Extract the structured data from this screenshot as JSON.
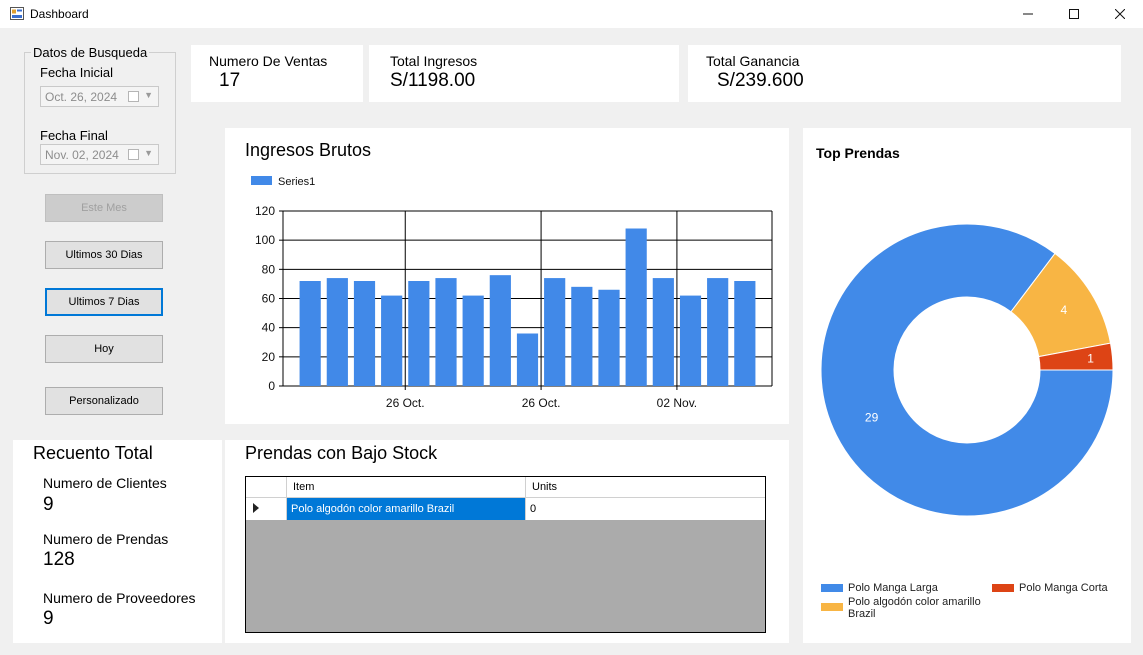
{
  "window": {
    "title": "Dashboard",
    "minimize": "—",
    "maximize": "☐",
    "close": "✕"
  },
  "search": {
    "group_title": "Datos de Busqueda",
    "start_label": "Fecha Inicial",
    "start_value": "Oct. 26, 2024",
    "end_label": "Fecha Final",
    "end_value": "Nov. 02, 2024"
  },
  "buttons": {
    "este_mes": "Este Mes",
    "ultimos_30": "Ultimos 30 Dias",
    "ultimos_7": "Ultimos 7 Dias",
    "hoy": "Hoy",
    "personalizado": "Personalizado"
  },
  "kpis": {
    "ventas": {
      "label": "Numero De Ventas",
      "value": "17"
    },
    "ingresos": {
      "label": "Total Ingresos",
      "value": "S/1198.00"
    },
    "ganancia": {
      "label": "Total Ganancia",
      "value": "S/239.600"
    }
  },
  "summary": {
    "title": "Recuento Total",
    "clientes_label": "Numero de Clientes",
    "clientes_value": "9",
    "prendas_label": "Numero de Prendas",
    "prendas_value": "128",
    "proveedores_label": "Numero de Proveedores",
    "proveedores_value": "9"
  },
  "low_stock": {
    "title": "Prendas con Bajo Stock",
    "columns": [
      "Item",
      "Units"
    ],
    "rows": [
      {
        "item": "Polo algodón color amarillo Brazil",
        "units": "0"
      }
    ]
  },
  "chart_data": [
    {
      "type": "bar",
      "title": "Ingresos Brutos",
      "series": [
        {
          "name": "Series1",
          "color": "#4189e8",
          "values": [
            72,
            74,
            72,
            62,
            72,
            74,
            62,
            76,
            36,
            74,
            68,
            66,
            108,
            74,
            62,
            74,
            72
          ]
        }
      ],
      "x_tick_labels": [
        "26 Oct.",
        "26 Oct.",
        "02 Nov."
      ],
      "ylim": [
        0,
        120
      ],
      "yticks": [
        0,
        20,
        40,
        60,
        80,
        100,
        120
      ],
      "grid": true,
      "legend": "top-left"
    },
    {
      "type": "pie",
      "title": "Top Prendas",
      "donut": true,
      "slices": [
        {
          "label": "Polo Manga Larga",
          "value": 29,
          "color": "#418ae8"
        },
        {
          "label": "Polo algodón color amarillo Brazil",
          "value": 4,
          "color": "#f8b544"
        },
        {
          "label": "Polo Manga Corta",
          "value": 1,
          "color": "#dd4415"
        }
      ],
      "legend": "bottom"
    }
  ]
}
